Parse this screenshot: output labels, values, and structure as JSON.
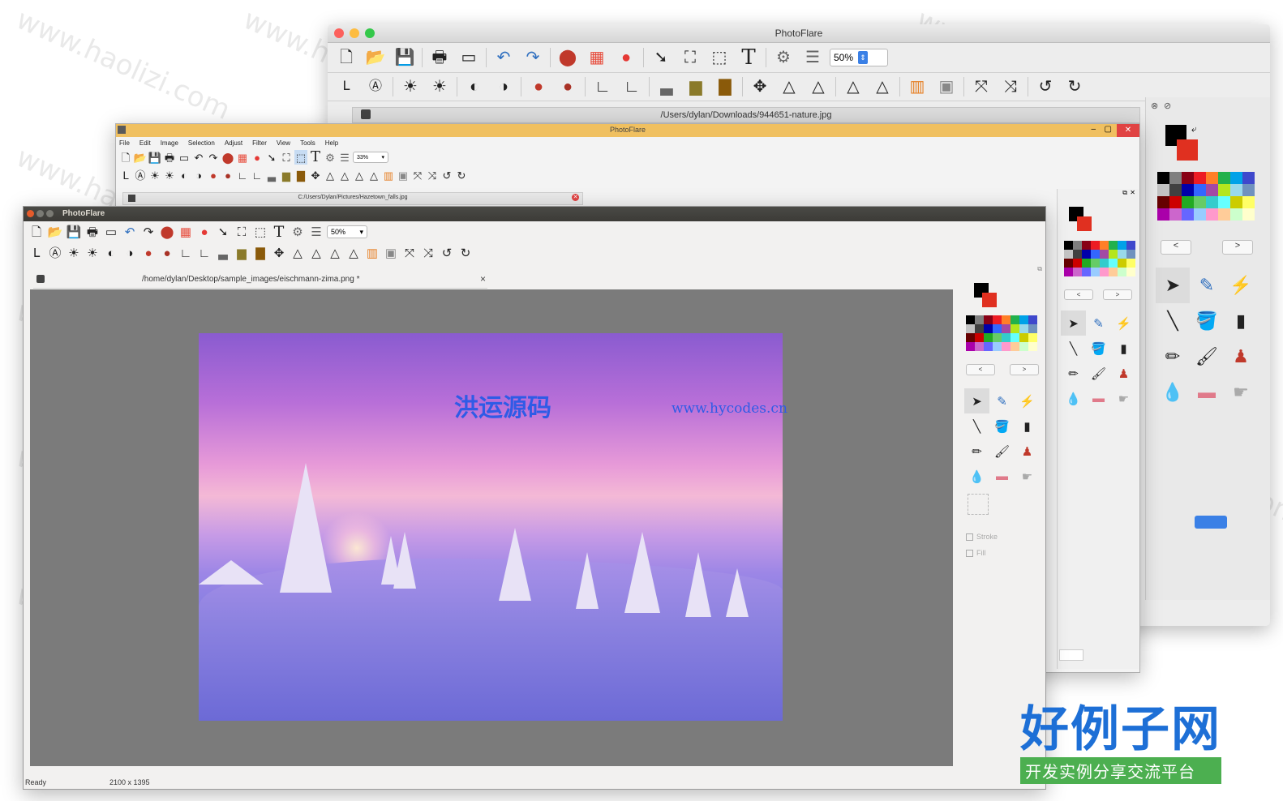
{
  "app": {
    "name": "PhotoFlare"
  },
  "mac_window": {
    "title": "PhotoFlare",
    "zoom": "50%",
    "tab_path": "/Users/dylan/Downloads/944651-nature.jpg",
    "nav_prev": "<",
    "nav_next": ">"
  },
  "win_window": {
    "title": "PhotoFlare",
    "menu": [
      "File",
      "Edit",
      "Image",
      "Selection",
      "Adjust",
      "Filter",
      "View",
      "Tools",
      "Help"
    ],
    "zoom": "33%",
    "tab_path": "C:/Users/Dylan/Pictures/Hazetown_falls.jpg",
    "nav_prev": "<",
    "nav_next": ">"
  },
  "ubuntu_window": {
    "title": "PhotoFlare",
    "zoom": "50%",
    "tab_path": "/home/dylan/Desktop/sample_images/eischmann-zima.png *",
    "tab_close": "×",
    "nav_prev": "<",
    "nav_next": ">",
    "stroke_label": "Stroke",
    "fill_label": "Fill",
    "status_text": "Ready",
    "image_size": "2100 x 1395"
  },
  "image_watermark": {
    "cn": "洪运源码",
    "url": "www.hycodes.cn"
  },
  "site_watermark": "www.haolizi.com",
  "corner_logo": {
    "title": "好例子网",
    "subtitle": "开发实例分享交流平台"
  },
  "colors": {
    "accent_blue": "#2f5be6",
    "ubuntu_title": "#3c3b37",
    "win_title": "#f0c060",
    "canvas_bg": "#7b7b7b"
  }
}
